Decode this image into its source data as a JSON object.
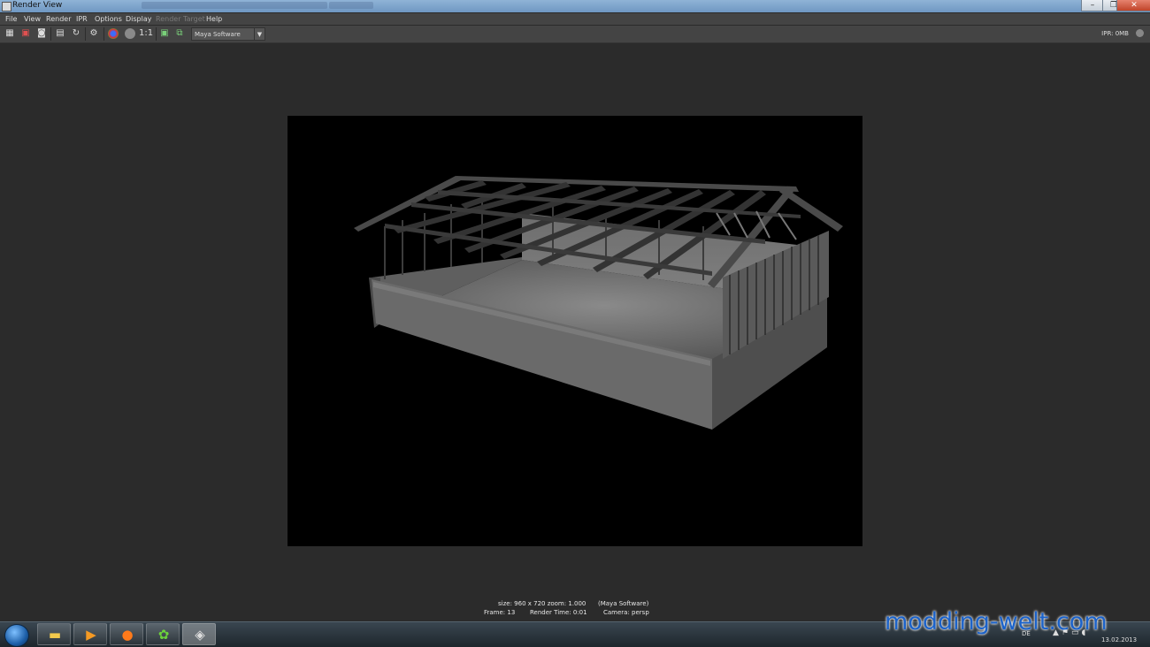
{
  "window": {
    "title": "Render View"
  },
  "menu": [
    "File",
    "View",
    "Render",
    "IPR",
    "Options",
    "Display",
    "Render Target",
    "Help"
  ],
  "menu_disabled": [
    "Render Target"
  ],
  "toolbar": {
    "zoom_label": "1:1",
    "renderer": "Maya Software",
    "ipr_status": "IPR: 0MB",
    "icons": [
      "redo-render-icon",
      "ipr-render-icon",
      "snapshot-icon",
      "render-region-icon",
      "refresh-icon",
      "color-channels-icon",
      "alpha-channel-icon",
      "zoom-1to1-icon",
      "keep-image-icon",
      "remove-image-icon"
    ]
  },
  "status": {
    "line1_size": "size: 960 x 720 zoom: 1.000",
    "line1_renderer": "(Maya Software)",
    "line2_frame": "Frame: 13",
    "line2_time": "Render Time: 0:01",
    "line2_camera": "Camera: persp"
  },
  "taskbar": {
    "apps": [
      "explorer-icon",
      "media-player-icon",
      "firefox-icon",
      "icq-icon",
      "maya-icon"
    ],
    "tray_lang": "DE",
    "tray_date": "13.02.2013"
  },
  "watermark": "modding-welt.com",
  "colors": {
    "viewport_bg": "#2b2b2b",
    "menubar": "#444444",
    "render_bg": "#000000",
    "titlebar": "#7aa2cc",
    "watermark": "#1b62c9"
  }
}
